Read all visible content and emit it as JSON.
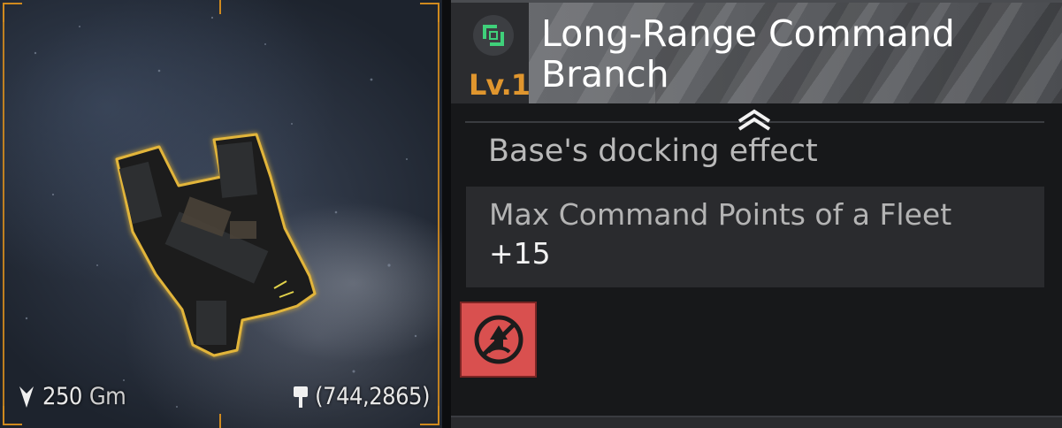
{
  "preview": {
    "distance_value": "250",
    "distance_unit": "Gm",
    "distance_icon": "arrow-down-icon",
    "coordinates": "(744,2865)",
    "location_icon": "pin-icon",
    "frame_color": "#d08a1e"
  },
  "module": {
    "type_icon": "branch-module-icon",
    "level": "Lv.1",
    "title": "Long-Range Command Branch",
    "level_color": "#e0962e"
  },
  "effects": {
    "section_label": "Base's docking effect",
    "items": [
      {
        "name": "Max Command Points of a Fleet",
        "value": "+15"
      }
    ]
  },
  "actions": {
    "restrict_icon": "no-dock-icon",
    "restrict_color": "#d9504f"
  }
}
